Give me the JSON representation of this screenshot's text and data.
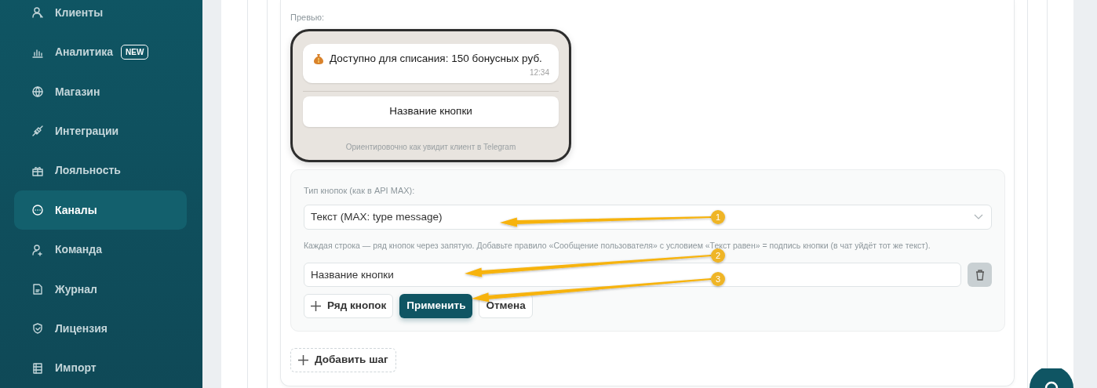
{
  "sidebar": {
    "items": [
      {
        "label": "Клиенты",
        "selected": false
      },
      {
        "label": "Аналитика",
        "badge": "NEW",
        "selected": false
      },
      {
        "label": "Магазин",
        "selected": false
      },
      {
        "label": "Интеграции",
        "selected": false
      },
      {
        "label": "Лояльность",
        "selected": false
      },
      {
        "label": "Каналы",
        "selected": true
      },
      {
        "label": "Команда",
        "selected": false
      },
      {
        "label": "Журнал",
        "selected": false
      },
      {
        "label": "Лицензия",
        "selected": false
      },
      {
        "label": "Импорт",
        "selected": false
      }
    ]
  },
  "preview": {
    "label": "Превью:",
    "message": "Доступно для списания: 150 бонусных руб.",
    "time": "12:34",
    "button": "Название кнопки",
    "caption": "Ориентировочно как увидит клиент в Telegram"
  },
  "button_settings": {
    "type_label": "Тип кнопок (как в API MAX):",
    "type_value": "Текст (MAX: type message)",
    "hint": "Каждая строка — ряд кнопок через запятую. Добавьте правило «Сообщение пользователя» с условием «Текст равен» = подпись кнопки (в чат уйдёт тот же текст).",
    "rows": [
      {
        "value": "Название кнопки"
      }
    ],
    "add_row": "Ряд кнопок",
    "apply": "Применить",
    "cancel": "Отмена"
  },
  "add_step": "Добавить шаг",
  "annotations": [
    {
      "number": "1"
    },
    {
      "number": "2"
    },
    {
      "number": "3"
    }
  ]
}
